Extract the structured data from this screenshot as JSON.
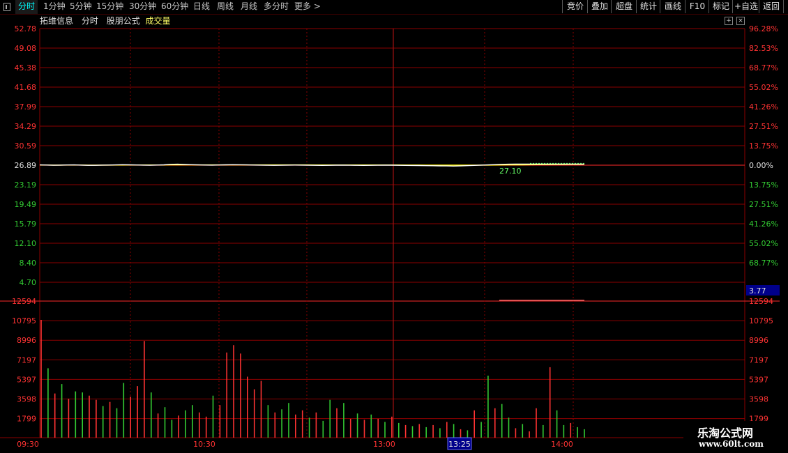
{
  "toolbar": {
    "tabs": [
      "分时",
      "1分钟",
      "5分钟",
      "15分钟",
      "30分钟",
      "60分钟",
      "日线",
      "周线",
      "月线",
      "多分时",
      "更多 >"
    ],
    "active_tab": "分时",
    "right_buttons": [
      "竞价",
      "叠加",
      "超盘",
      "统计",
      "画线",
      "F10",
      "标记",
      "+自选",
      "返回"
    ]
  },
  "title": {
    "stock_name": "拓维信息",
    "chart_kind": "分时",
    "formula": "股朋公式",
    "indicator": "成交量"
  },
  "colors": {
    "background": "#000000",
    "grid": "#8b0000",
    "up": "#ff3333",
    "down": "#33cc33",
    "price_line": "#ffffff",
    "avg_line": "#ffff00",
    "highlight_box": "#00008b"
  },
  "icons": [
    "sidebar-toggle-icon",
    "zoom-in-icon",
    "close-icon"
  ],
  "chart_data": {
    "type": "line",
    "price_axis_left": [
      "52.78",
      "49.08",
      "45.38",
      "41.68",
      "37.99",
      "34.29",
      "30.59",
      "26.89",
      "23.19",
      "19.49",
      "15.79",
      "12.10",
      "8.40",
      "4.70"
    ],
    "percent_axis_right": [
      "96.28%",
      "82.53%",
      "68.77%",
      "55.02%",
      "41.26%",
      "27.51%",
      "13.75%",
      "0.00%",
      "13.75%",
      "27.51%",
      "41.26%",
      "55.02%",
      "68.77%"
    ],
    "price_ylim": [
      4.7,
      52.78
    ],
    "prev_close": 26.89,
    "current_price_label": "27.10",
    "cursor_value": "3.77",
    "volume_axis": [
      "12594",
      "10795",
      "8996",
      "7197",
      "5397",
      "3598",
      "1799"
    ],
    "volume_ylim": [
      0,
      12594
    ],
    "time_labels": [
      "09:30",
      "10:30",
      "13:00",
      "13:25",
      "14:00"
    ],
    "cursor_time": "13:25",
    "price_series": [
      26.95,
      26.92,
      26.88,
      26.9,
      26.93,
      26.95,
      26.91,
      26.87,
      26.86,
      26.9,
      26.92,
      26.95,
      26.98,
      26.96,
      26.93,
      26.9,
      26.88,
      26.92,
      26.96,
      27.05,
      27.08,
      27.02,
      26.98,
      26.95,
      26.92,
      26.9,
      26.93,
      26.96,
      26.98,
      26.97,
      26.95,
      26.92,
      26.9,
      26.88,
      26.87,
      26.88,
      26.9,
      26.92,
      26.9,
      26.88,
      26.86,
      26.85,
      26.87,
      26.89,
      26.9,
      26.88,
      26.86,
      26.85,
      26.86,
      26.88,
      26.9,
      26.89,
      26.87,
      26.85,
      26.84,
      26.82,
      26.8,
      26.78,
      26.76,
      26.74,
      26.72,
      26.75,
      26.8,
      26.85,
      26.9,
      26.95,
      27.0,
      27.05,
      27.08,
      27.1,
      27.1,
      27.1,
      27.1,
      27.1,
      27.1,
      27.1,
      27.1,
      27.1,
      27.1,
      27.1
    ],
    "avg_series": [
      26.93,
      26.92,
      26.91,
      26.91,
      26.92,
      26.92,
      26.92,
      26.91,
      26.91,
      26.91,
      26.91,
      26.92,
      26.92,
      26.93,
      26.93,
      26.93,
      26.93,
      26.93,
      26.93,
      26.94,
      26.95,
      26.95,
      26.95,
      26.95,
      26.95,
      26.95,
      26.95,
      26.95,
      26.95,
      26.95,
      26.95,
      26.95,
      26.95,
      26.94,
      26.94,
      26.94,
      26.94,
      26.94,
      26.94,
      26.94,
      26.93,
      26.93,
      26.93,
      26.93,
      26.93,
      26.93,
      26.93,
      26.93,
      26.93,
      26.93,
      26.93,
      26.93,
      26.93,
      26.92,
      26.92,
      26.92,
      26.91,
      26.91,
      26.9,
      26.9,
      26.89,
      26.89,
      26.89,
      26.9,
      26.9,
      26.91,
      26.92,
      26.93,
      26.94,
      26.95,
      26.96,
      26.97,
      26.98,
      26.99,
      27.0,
      27.01,
      27.02,
      27.03,
      27.04,
      27.05
    ],
    "volume_series": [
      {
        "v": 11200,
        "c": "up"
      },
      {
        "v": 6600,
        "c": "down"
      },
      {
        "v": 4200,
        "c": "up"
      },
      {
        "v": 5100,
        "c": "down"
      },
      {
        "v": 3700,
        "c": "up"
      },
      {
        "v": 4400,
        "c": "down"
      },
      {
        "v": 4300,
        "c": "down"
      },
      {
        "v": 4000,
        "c": "up"
      },
      {
        "v": 3600,
        "c": "up"
      },
      {
        "v": 3000,
        "c": "down"
      },
      {
        "v": 3400,
        "c": "up"
      },
      {
        "v": 2800,
        "c": "down"
      },
      {
        "v": 5200,
        "c": "down"
      },
      {
        "v": 3900,
        "c": "up"
      },
      {
        "v": 4900,
        "c": "up"
      },
      {
        "v": 9200,
        "c": "up"
      },
      {
        "v": 4300,
        "c": "down"
      },
      {
        "v": 2300,
        "c": "up"
      },
      {
        "v": 2900,
        "c": "down"
      },
      {
        "v": 1700,
        "c": "down"
      },
      {
        "v": 2100,
        "c": "up"
      },
      {
        "v": 2600,
        "c": "down"
      },
      {
        "v": 3100,
        "c": "down"
      },
      {
        "v": 2400,
        "c": "up"
      },
      {
        "v": 2000,
        "c": "up"
      },
      {
        "v": 4000,
        "c": "down"
      },
      {
        "v": 3100,
        "c": "up"
      },
      {
        "v": 8100,
        "c": "up"
      },
      {
        "v": 8800,
        "c": "up"
      },
      {
        "v": 8000,
        "c": "up"
      },
      {
        "v": 5800,
        "c": "up"
      },
      {
        "v": 4600,
        "c": "up"
      },
      {
        "v": 5400,
        "c": "up"
      },
      {
        "v": 3100,
        "c": "down"
      },
      {
        "v": 2400,
        "c": "up"
      },
      {
        "v": 2700,
        "c": "down"
      },
      {
        "v": 3300,
        "c": "down"
      },
      {
        "v": 2200,
        "c": "up"
      },
      {
        "v": 2600,
        "c": "up"
      },
      {
        "v": 1900,
        "c": "down"
      },
      {
        "v": 2400,
        "c": "up"
      },
      {
        "v": 1600,
        "c": "down"
      },
      {
        "v": 3600,
        "c": "down"
      },
      {
        "v": 2800,
        "c": "up"
      },
      {
        "v": 3300,
        "c": "down"
      },
      {
        "v": 1800,
        "c": "up"
      },
      {
        "v": 2300,
        "c": "down"
      },
      {
        "v": 1700,
        "c": "up"
      },
      {
        "v": 2200,
        "c": "down"
      },
      {
        "v": 1800,
        "c": "up"
      },
      {
        "v": 1500,
        "c": "down"
      },
      {
        "v": 2000,
        "c": "up"
      },
      {
        "v": 1400,
        "c": "down"
      },
      {
        "v": 1200,
        "c": "up"
      },
      {
        "v": 1100,
        "c": "down"
      },
      {
        "v": 1300,
        "c": "up"
      },
      {
        "v": 1000,
        "c": "down"
      },
      {
        "v": 1200,
        "c": "up"
      },
      {
        "v": 900,
        "c": "down"
      },
      {
        "v": 1500,
        "c": "up"
      },
      {
        "v": 1300,
        "c": "down"
      },
      {
        "v": 800,
        "c": "up"
      },
      {
        "v": 700,
        "c": "down"
      },
      {
        "v": 2600,
        "c": "up"
      },
      {
        "v": 1500,
        "c": "down"
      },
      {
        "v": 5900,
        "c": "down"
      },
      {
        "v": 2800,
        "c": "up"
      },
      {
        "v": 3200,
        "c": "down"
      },
      {
        "v": 1900,
        "c": "down"
      },
      {
        "v": 900,
        "c": "up"
      },
      {
        "v": 1300,
        "c": "down"
      },
      {
        "v": 600,
        "c": "up"
      },
      {
        "v": 2800,
        "c": "up"
      },
      {
        "v": 1200,
        "c": "down"
      },
      {
        "v": 6700,
        "c": "up"
      },
      {
        "v": 2600,
        "c": "down"
      },
      {
        "v": 1200,
        "c": "down"
      },
      {
        "v": 1400,
        "c": "up"
      },
      {
        "v": 1000,
        "c": "down"
      },
      {
        "v": 800,
        "c": "down"
      }
    ]
  },
  "logo": {
    "name": "乐淘公式网",
    "url": "www.60lt.com"
  }
}
